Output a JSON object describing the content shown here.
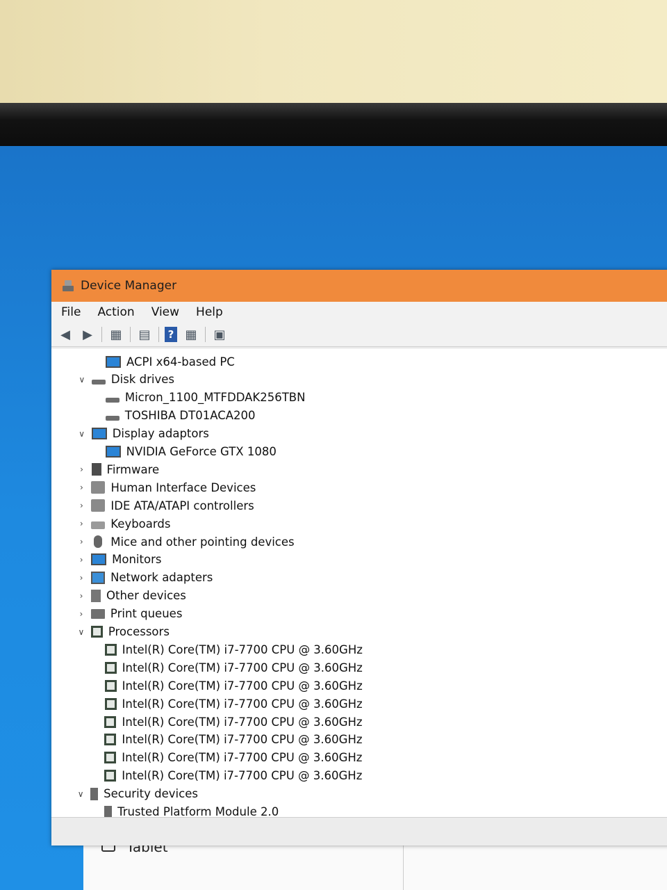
{
  "window": {
    "title": "Device Manager"
  },
  "menu": [
    "File",
    "Action",
    "View",
    "Help"
  ],
  "toolbar": {
    "back_icon": "back-arrow-icon",
    "forward_icon": "forward-arrow-icon",
    "help_glyph": "?"
  },
  "tree": [
    {
      "label": "ACPI x64-based PC",
      "level": 2,
      "expand": "none",
      "icon": "monitor-icon"
    },
    {
      "label": "Disk drives",
      "level": 1,
      "expand": "expanded",
      "icon": "disk-drive-icon"
    },
    {
      "label": "Micron_1100_MTFDDAK256TBN",
      "level": 2,
      "expand": "none",
      "icon": "disk-drive-icon"
    },
    {
      "label": "TOSHIBA DT01ACA200",
      "level": 2,
      "expand": "none",
      "icon": "disk-drive-icon"
    },
    {
      "label": "Display adaptors",
      "level": 1,
      "expand": "expanded",
      "icon": "display-adapter-icon"
    },
    {
      "label": "NVIDIA GeForce GTX 1080",
      "level": 2,
      "expand": "none",
      "icon": "display-adapter-icon"
    },
    {
      "label": "Firmware",
      "level": 1,
      "expand": "collapsed",
      "icon": "firmware-icon"
    },
    {
      "label": "Human Interface Devices",
      "level": 1,
      "expand": "collapsed",
      "icon": "hid-icon"
    },
    {
      "label": "IDE ATA/ATAPI controllers",
      "level": 1,
      "expand": "collapsed",
      "icon": "ide-controller-icon"
    },
    {
      "label": "Keyboards",
      "level": 1,
      "expand": "collapsed",
      "icon": "keyboard-icon"
    },
    {
      "label": "Mice and other pointing devices",
      "level": 1,
      "expand": "collapsed",
      "icon": "mouse-icon"
    },
    {
      "label": "Monitors",
      "level": 1,
      "expand": "collapsed",
      "icon": "monitor-icon"
    },
    {
      "label": "Network adapters",
      "level": 1,
      "expand": "collapsed",
      "icon": "network-adapter-icon"
    },
    {
      "label": "Other devices",
      "level": 1,
      "expand": "collapsed",
      "icon": "other-devices-icon"
    },
    {
      "label": "Print queues",
      "level": 1,
      "expand": "collapsed",
      "icon": "printer-icon"
    },
    {
      "label": "Processors",
      "level": 1,
      "expand": "expanded",
      "icon": "processor-icon"
    },
    {
      "label": "Intel(R) Core(TM) i7-7700 CPU @ 3.60GHz",
      "level": 2,
      "expand": "none",
      "icon": "processor-icon"
    },
    {
      "label": "Intel(R) Core(TM) i7-7700 CPU @ 3.60GHz",
      "level": 2,
      "expand": "none",
      "icon": "processor-icon"
    },
    {
      "label": "Intel(R) Core(TM) i7-7700 CPU @ 3.60GHz",
      "level": 2,
      "expand": "none",
      "icon": "processor-icon"
    },
    {
      "label": "Intel(R) Core(TM) i7-7700 CPU @ 3.60GHz",
      "level": 2,
      "expand": "none",
      "icon": "processor-icon"
    },
    {
      "label": "Intel(R) Core(TM) i7-7700 CPU @ 3.60GHz",
      "level": 2,
      "expand": "none",
      "icon": "processor-icon"
    },
    {
      "label": "Intel(R) Core(TM) i7-7700 CPU @ 3.60GHz",
      "level": 2,
      "expand": "none",
      "icon": "processor-icon"
    },
    {
      "label": "Intel(R) Core(TM) i7-7700 CPU @ 3.60GHz",
      "level": 2,
      "expand": "none",
      "icon": "processor-icon"
    },
    {
      "label": "Intel(R) Core(TM) i7-7700 CPU @ 3.60GHz",
      "level": 2,
      "expand": "none",
      "icon": "processor-icon"
    },
    {
      "label": "Security devices",
      "level": 1,
      "expand": "expanded",
      "icon": "security-device-icon"
    },
    {
      "label": "Trusted Platform Module 2.0",
      "level": 2,
      "expand": "none",
      "icon": "security-device-icon"
    }
  ],
  "background_window": {
    "item_label": "Tablet",
    "item_icon": "tablet-icon"
  },
  "colors": {
    "titlebar": "#f08a3c",
    "desktop": "#1e88d8"
  }
}
